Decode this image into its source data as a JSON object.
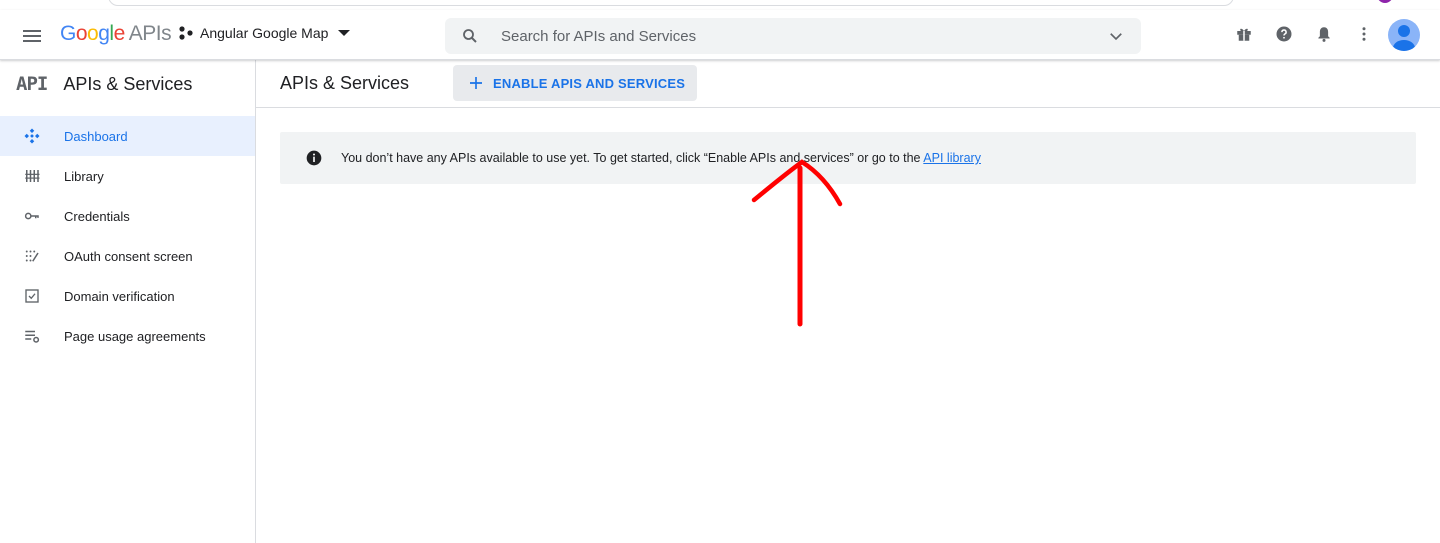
{
  "header": {
    "logo_google": "Google",
    "logo_apis": "APIs",
    "project_name": "Angular Google Map",
    "search_placeholder": "Search for APIs and Services"
  },
  "sidebar": {
    "section_glyph": "API",
    "section_title": "APIs & Services",
    "items": [
      {
        "label": "Dashboard",
        "icon": "dashboard-icon",
        "active": true
      },
      {
        "label": "Library",
        "icon": "library-icon",
        "active": false
      },
      {
        "label": "Credentials",
        "icon": "key-icon",
        "active": false
      },
      {
        "label": "OAuth consent screen",
        "icon": "oauth-icon",
        "active": false
      },
      {
        "label": "Domain verification",
        "icon": "checkbox-icon",
        "active": false
      },
      {
        "label": "Page usage agreements",
        "icon": "settings-list-icon",
        "active": false
      }
    ]
  },
  "main": {
    "title": "APIs & Services",
    "enable_button": "ENABLE APIS AND SERVICES",
    "banner_text": "You don’t have any APIs available to use yet. To get started, click “Enable APIs and services” or go to the ",
    "banner_link": "API library"
  },
  "colors": {
    "accent": "#1a73e8",
    "active_bg": "#e8f0fe",
    "annotation_arrow": "#ff0000"
  }
}
